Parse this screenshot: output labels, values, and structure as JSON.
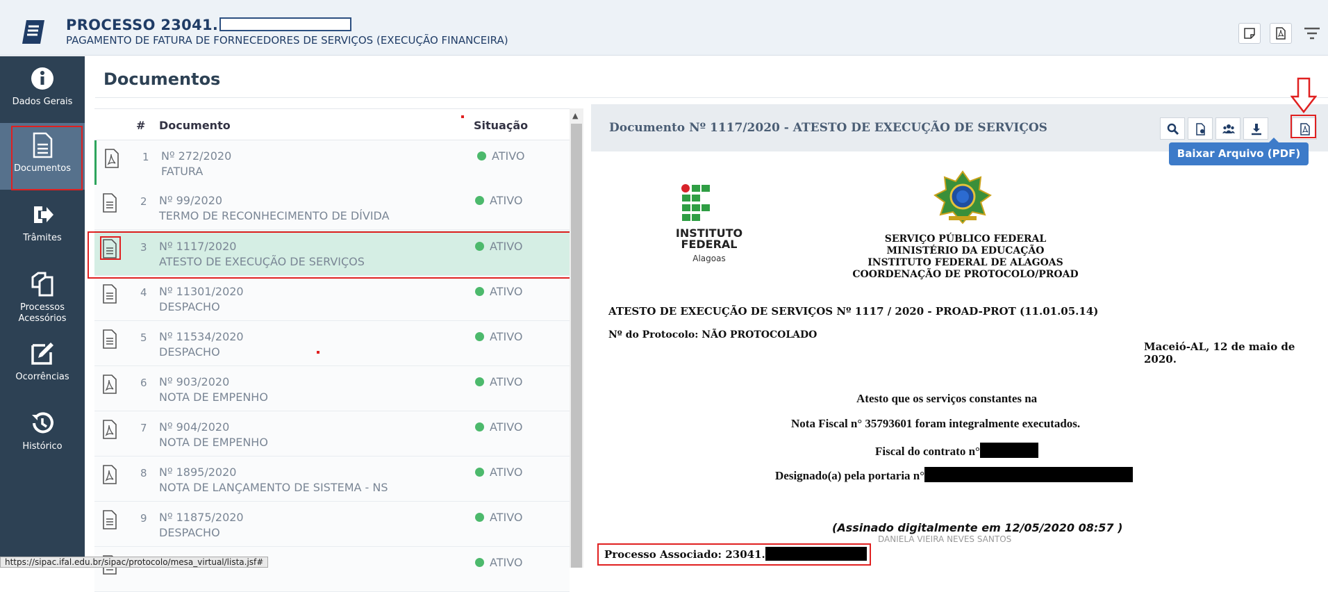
{
  "header": {
    "title_prefix": "PROCESSO 23041.",
    "subtitle": "PAGAMENTO DE FATURA DE FORNECEDORES DE SERVIÇOS (EXECUÇÃO FINANCEIRA)"
  },
  "sidebar": {
    "items": [
      {
        "label": "Dados Gerais",
        "icon": "info-icon"
      },
      {
        "label": "Documentos",
        "icon": "document-icon",
        "active": true
      },
      {
        "label": "Trâmites",
        "icon": "sign-out-icon"
      },
      {
        "label": "Processos\nAcessórios",
        "icon": "copy-icon"
      },
      {
        "label": "Ocorrências",
        "icon": "edit-icon"
      },
      {
        "label": "Histórico",
        "icon": "history-icon"
      }
    ]
  },
  "section_title": "Documentos",
  "table": {
    "headers": {
      "num": "#",
      "doc": "Documento",
      "sit": "Situação"
    },
    "rows": [
      {
        "num": "1",
        "doc_num": "Nº 272/2020",
        "doc_type": "FATURA",
        "status": "ATIVO",
        "icon": "pdf-file-icon"
      },
      {
        "num": "2",
        "doc_num": "Nº 99/2020",
        "doc_type": "TERMO DE RECONHECIMENTO DE DÍVIDA",
        "status": "ATIVO",
        "icon": "text-file-icon"
      },
      {
        "num": "3",
        "doc_num": "Nº 1117/2020",
        "doc_type": "ATESTO DE EXECUÇÃO DE SERVIÇOS",
        "status": "ATIVO",
        "icon": "text-file-icon"
      },
      {
        "num": "4",
        "doc_num": "Nº 11301/2020",
        "doc_type": "DESPACHO",
        "status": "ATIVO",
        "icon": "text-file-icon"
      },
      {
        "num": "5",
        "doc_num": "Nº 11534/2020",
        "doc_type": "DESPACHO",
        "status": "ATIVO",
        "icon": "text-file-icon"
      },
      {
        "num": "6",
        "doc_num": "Nº 903/2020",
        "doc_type": "NOTA DE EMPENHO",
        "status": "ATIVO",
        "icon": "pdf-file-icon"
      },
      {
        "num": "7",
        "doc_num": "Nº 904/2020",
        "doc_type": "NOTA DE EMPENHO",
        "status": "ATIVO",
        "icon": "pdf-file-icon"
      },
      {
        "num": "8",
        "doc_num": "Nº 1895/2020",
        "doc_type": "NOTA DE LANÇAMENTO DE SISTEMA - NS",
        "status": "ATIVO",
        "icon": "pdf-file-icon"
      },
      {
        "num": "9",
        "doc_num": "Nº 11875/2020",
        "doc_type": "DESPACHO",
        "status": "ATIVO",
        "icon": "text-file-icon"
      },
      {
        "num": "",
        "doc_num": "",
        "doc_type": "",
        "status": "ATIVO",
        "icon": "text-file-icon"
      }
    ]
  },
  "viewer": {
    "title": "Documento Nº 1117/2020 - ATESTO DE EXECUÇÃO DE SERVIÇOS",
    "tooltip": "Baixar Arquivo (PDF)",
    "toolbar_icons": [
      "search-icon",
      "file-view-icon",
      "users-icon",
      "download-icon",
      "pdf-icon"
    ]
  },
  "document": {
    "inst_name_1": "INSTITUTO",
    "inst_name_2": "FEDERAL",
    "inst_sub": "Alagoas",
    "gov_lines": [
      "SERVIÇO PÚBLICO FEDERAL",
      "MINISTÉRIO DA EDUCAÇÃO",
      "INSTITUTO FEDERAL DE ALAGOAS",
      "COORDENAÇÃO DE PROTOCOLO/PROAD"
    ],
    "heading": "ATESTO DE EXECUÇÃO DE SERVIÇOS Nº 1117 / 2020 - PROAD-PROT (11.01.05.14)",
    "protocol": "Nº do Protocolo: NÃO PROTOCOLADO",
    "date": "Maceió-AL, 12 de maio de 2020.",
    "body_1": "Atesto que os serviços constantes na",
    "body_2": "Nota Fiscal n° 35793601 foram integralmente executados.",
    "body_3": "Fiscal do contrato n°",
    "body_4": "Designado(a) pela portaria n°",
    "signed": "(Assinado digitalmente em 12/05/2020 08:57 )",
    "signer_ghost": "DANIELA VIEIRA NEVES SANTOS",
    "assoc": "Processo Associado: 23041."
  },
  "statusbar": "https://sipac.ifal.edu.br/sipac/protocolo/mesa_virtual/lista.jsf#",
  "colors": {
    "sidebar": "#2d4154",
    "accent": "#3d7bc9",
    "status_green": "#4cb96c",
    "highlight": "#e02020"
  }
}
